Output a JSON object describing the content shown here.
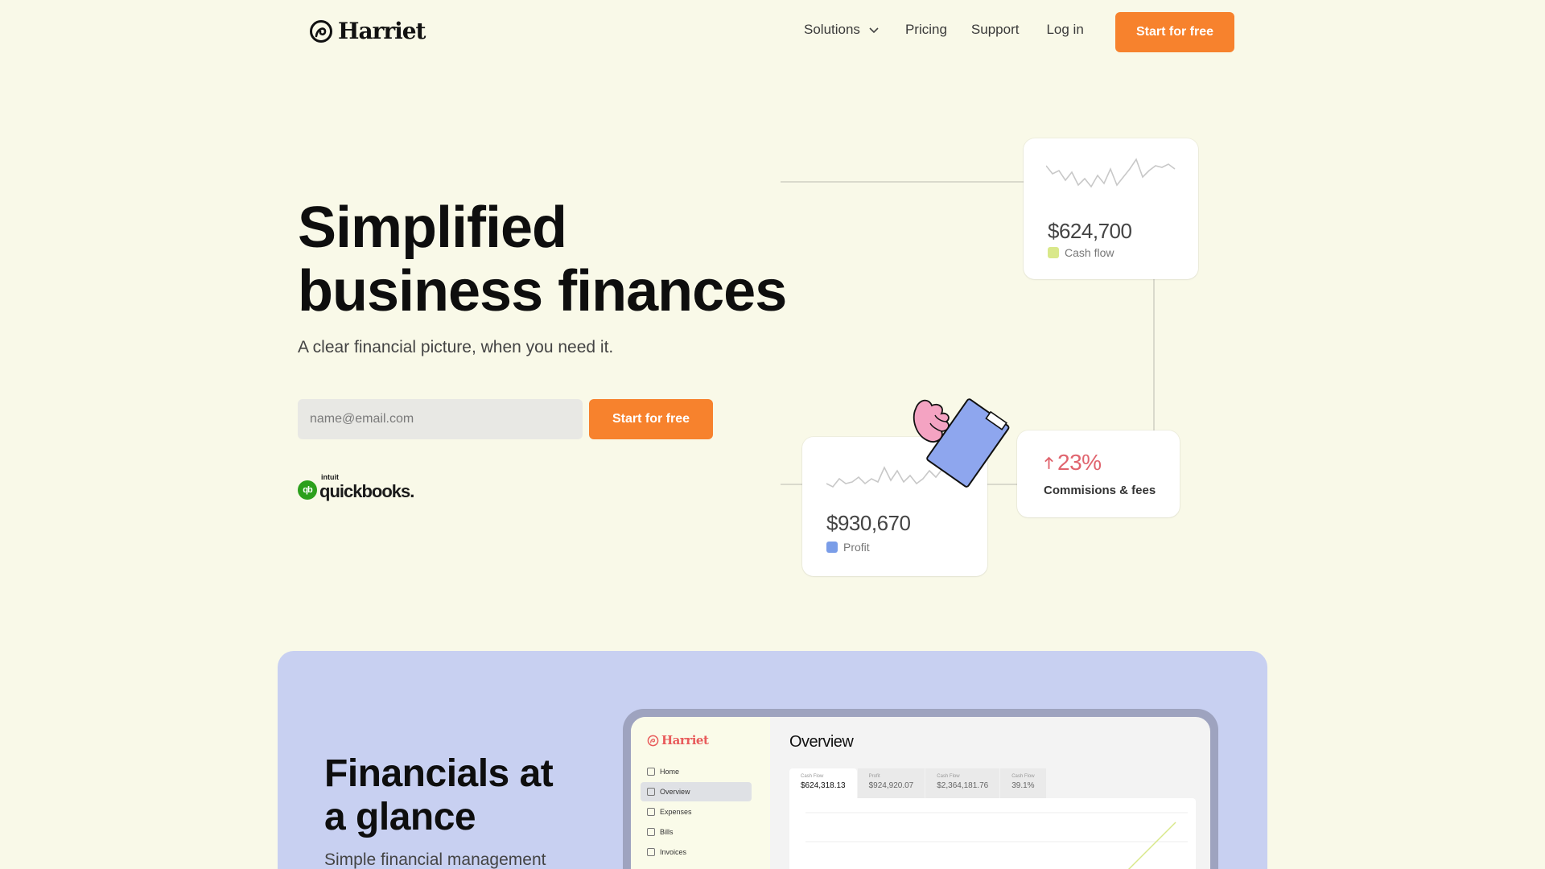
{
  "brand": {
    "name": "Harriet"
  },
  "nav": {
    "solutions": "Solutions",
    "pricing": "Pricing",
    "support": "Support",
    "login": "Log in",
    "cta": "Start for free"
  },
  "hero": {
    "title_line1": "Simplified",
    "title_line2": "business finances",
    "subtitle": "A clear financial picture, when you need it.",
    "email_placeholder": "name@email.com",
    "cta": "Start for free",
    "partner_prefix": "intuit",
    "partner": "quickbooks."
  },
  "illustration": {
    "cash_flow": {
      "value": "$624,700",
      "label": "Cash flow",
      "color": "#d9e88a"
    },
    "profit": {
      "value": "$930,670",
      "label": "Profit",
      "color": "#7a9de8"
    },
    "commissions": {
      "value": "23%",
      "label": "Commisions & fees",
      "color": "#e0646e"
    }
  },
  "section2": {
    "title_line1": "Financials at",
    "title_line2": "a glance",
    "subtitle": "Simple financial management",
    "app": {
      "brand": "Harriet",
      "nav": [
        "Home",
        "Overview",
        "Expenses",
        "Bills",
        "Invoices"
      ],
      "active_nav": "Overview",
      "heading": "Overview",
      "stats": [
        {
          "key": "Cash Flow",
          "value": "$624,318.13"
        },
        {
          "key": "Profit",
          "value": "$924,920.07"
        },
        {
          "key": "Cash Flow",
          "value": "$2,364,181.76"
        },
        {
          "key": "Cash Flow",
          "value": "39.1%"
        }
      ]
    }
  },
  "colors": {
    "accent": "#f7822d",
    "background": "#f9f9e8",
    "section2_bg": "#c8d0f1"
  }
}
